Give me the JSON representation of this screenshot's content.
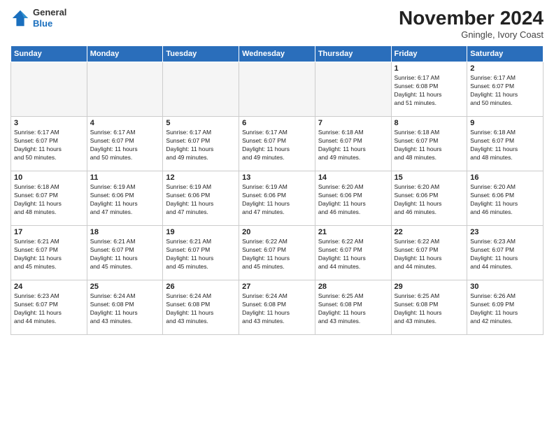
{
  "logo": {
    "general": "General",
    "blue": "Blue"
  },
  "title": "November 2024",
  "location": "Gningle, Ivory Coast",
  "weekdays": [
    "Sunday",
    "Monday",
    "Tuesday",
    "Wednesday",
    "Thursday",
    "Friday",
    "Saturday"
  ],
  "weeks": [
    [
      {
        "day": "",
        "info": ""
      },
      {
        "day": "",
        "info": ""
      },
      {
        "day": "",
        "info": ""
      },
      {
        "day": "",
        "info": ""
      },
      {
        "day": "",
        "info": ""
      },
      {
        "day": "1",
        "info": "Sunrise: 6:17 AM\nSunset: 6:08 PM\nDaylight: 11 hours\nand 51 minutes."
      },
      {
        "day": "2",
        "info": "Sunrise: 6:17 AM\nSunset: 6:07 PM\nDaylight: 11 hours\nand 50 minutes."
      }
    ],
    [
      {
        "day": "3",
        "info": "Sunrise: 6:17 AM\nSunset: 6:07 PM\nDaylight: 11 hours\nand 50 minutes."
      },
      {
        "day": "4",
        "info": "Sunrise: 6:17 AM\nSunset: 6:07 PM\nDaylight: 11 hours\nand 50 minutes."
      },
      {
        "day": "5",
        "info": "Sunrise: 6:17 AM\nSunset: 6:07 PM\nDaylight: 11 hours\nand 49 minutes."
      },
      {
        "day": "6",
        "info": "Sunrise: 6:17 AM\nSunset: 6:07 PM\nDaylight: 11 hours\nand 49 minutes."
      },
      {
        "day": "7",
        "info": "Sunrise: 6:18 AM\nSunset: 6:07 PM\nDaylight: 11 hours\nand 49 minutes."
      },
      {
        "day": "8",
        "info": "Sunrise: 6:18 AM\nSunset: 6:07 PM\nDaylight: 11 hours\nand 48 minutes."
      },
      {
        "day": "9",
        "info": "Sunrise: 6:18 AM\nSunset: 6:07 PM\nDaylight: 11 hours\nand 48 minutes."
      }
    ],
    [
      {
        "day": "10",
        "info": "Sunrise: 6:18 AM\nSunset: 6:07 PM\nDaylight: 11 hours\nand 48 minutes."
      },
      {
        "day": "11",
        "info": "Sunrise: 6:19 AM\nSunset: 6:06 PM\nDaylight: 11 hours\nand 47 minutes."
      },
      {
        "day": "12",
        "info": "Sunrise: 6:19 AM\nSunset: 6:06 PM\nDaylight: 11 hours\nand 47 minutes."
      },
      {
        "day": "13",
        "info": "Sunrise: 6:19 AM\nSunset: 6:06 PM\nDaylight: 11 hours\nand 47 minutes."
      },
      {
        "day": "14",
        "info": "Sunrise: 6:20 AM\nSunset: 6:06 PM\nDaylight: 11 hours\nand 46 minutes."
      },
      {
        "day": "15",
        "info": "Sunrise: 6:20 AM\nSunset: 6:06 PM\nDaylight: 11 hours\nand 46 minutes."
      },
      {
        "day": "16",
        "info": "Sunrise: 6:20 AM\nSunset: 6:06 PM\nDaylight: 11 hours\nand 46 minutes."
      }
    ],
    [
      {
        "day": "17",
        "info": "Sunrise: 6:21 AM\nSunset: 6:07 PM\nDaylight: 11 hours\nand 45 minutes."
      },
      {
        "day": "18",
        "info": "Sunrise: 6:21 AM\nSunset: 6:07 PM\nDaylight: 11 hours\nand 45 minutes."
      },
      {
        "day": "19",
        "info": "Sunrise: 6:21 AM\nSunset: 6:07 PM\nDaylight: 11 hours\nand 45 minutes."
      },
      {
        "day": "20",
        "info": "Sunrise: 6:22 AM\nSunset: 6:07 PM\nDaylight: 11 hours\nand 45 minutes."
      },
      {
        "day": "21",
        "info": "Sunrise: 6:22 AM\nSunset: 6:07 PM\nDaylight: 11 hours\nand 44 minutes."
      },
      {
        "day": "22",
        "info": "Sunrise: 6:22 AM\nSunset: 6:07 PM\nDaylight: 11 hours\nand 44 minutes."
      },
      {
        "day": "23",
        "info": "Sunrise: 6:23 AM\nSunset: 6:07 PM\nDaylight: 11 hours\nand 44 minutes."
      }
    ],
    [
      {
        "day": "24",
        "info": "Sunrise: 6:23 AM\nSunset: 6:07 PM\nDaylight: 11 hours\nand 44 minutes."
      },
      {
        "day": "25",
        "info": "Sunrise: 6:24 AM\nSunset: 6:08 PM\nDaylight: 11 hours\nand 43 minutes."
      },
      {
        "day": "26",
        "info": "Sunrise: 6:24 AM\nSunset: 6:08 PM\nDaylight: 11 hours\nand 43 minutes."
      },
      {
        "day": "27",
        "info": "Sunrise: 6:24 AM\nSunset: 6:08 PM\nDaylight: 11 hours\nand 43 minutes."
      },
      {
        "day": "28",
        "info": "Sunrise: 6:25 AM\nSunset: 6:08 PM\nDaylight: 11 hours\nand 43 minutes."
      },
      {
        "day": "29",
        "info": "Sunrise: 6:25 AM\nSunset: 6:08 PM\nDaylight: 11 hours\nand 43 minutes."
      },
      {
        "day": "30",
        "info": "Sunrise: 6:26 AM\nSunset: 6:09 PM\nDaylight: 11 hours\nand 42 minutes."
      }
    ]
  ]
}
